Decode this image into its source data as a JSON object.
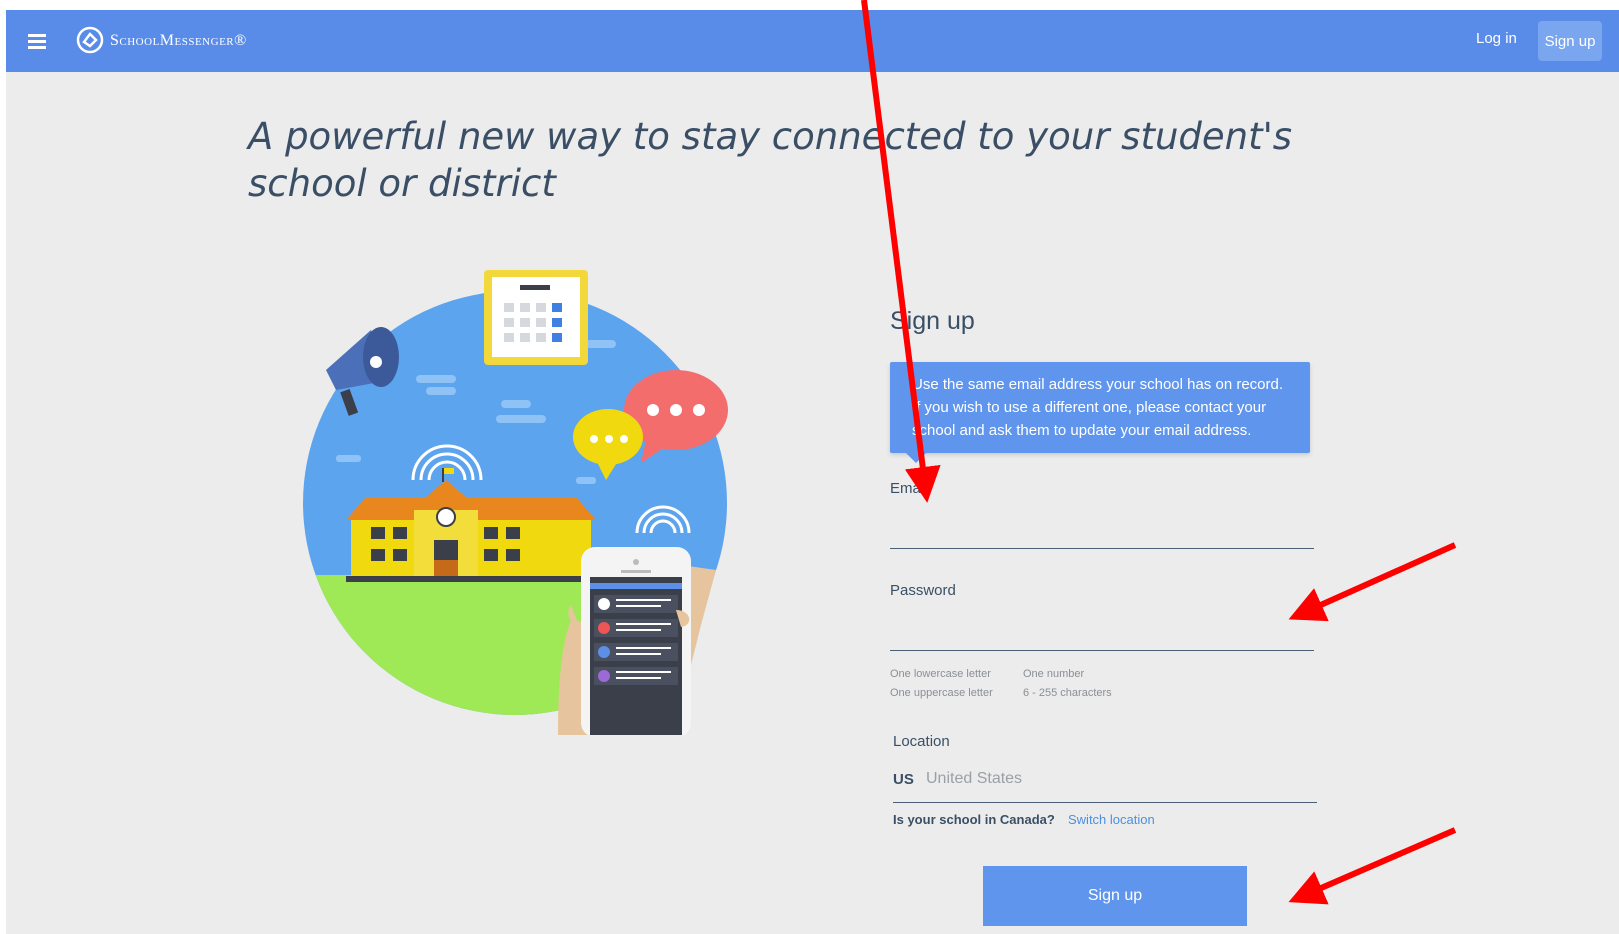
{
  "topbar": {
    "menu_icon": "hamburger-menu-icon",
    "brand": "SchoolMessenger®",
    "login_label": "Log in",
    "signup_label": "Sign up",
    "color": "#598ce8"
  },
  "headline": "A powerful new way to stay connected to your student's school or district",
  "form": {
    "title": "Sign up",
    "tooltip": "Use the same email address your school has on record. If you wish to use a different one, please contact your school and ask them to update your email address.",
    "email_label": "Email",
    "email_value": "",
    "password_label": "Password",
    "password_value": "",
    "password_rules": [
      "One lowercase letter",
      "One number",
      "One uppercase letter",
      "6 - 255 characters"
    ],
    "location_label": "Location",
    "location_code": "US",
    "location_value": "United States",
    "canada_question": "Is your school in Canada?",
    "switch_location": "Switch location",
    "submit_label": "Sign up"
  },
  "annotations": {
    "arrow_color": "#ff0000"
  }
}
